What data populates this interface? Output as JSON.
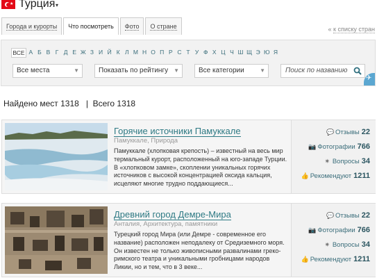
{
  "header": {
    "country": "Турция",
    "back_link": "к списку стран"
  },
  "tabs": [
    {
      "label": "Города и курорты"
    },
    {
      "label": "Что посмотреть"
    },
    {
      "label": "Фото"
    },
    {
      "label": "О стране"
    }
  ],
  "filter": {
    "letters": [
      "ВСЕ",
      "А",
      "Б",
      "В",
      "Г",
      "Д",
      "Е",
      "Ж",
      "З",
      "И",
      "Й",
      "К",
      "Л",
      "М",
      "Н",
      "О",
      "П",
      "Р",
      "С",
      "Т",
      "У",
      "Ф",
      "Х",
      "Ц",
      "Ч",
      "Ш",
      "Щ",
      "Э",
      "Ю",
      "Я"
    ],
    "places": "Все места",
    "rating": "Показать по рейтингу",
    "categories": "Все категории",
    "search_placeholder": "Поиск по названию"
  },
  "counts": {
    "found": "Найдено мест 1318",
    "total": "Всего 1318"
  },
  "cards": [
    {
      "title": "Горячие источники Памуккале",
      "category": "Памуккале, Природа",
      "description": "Памуккале (хлопковая крепость) – известный на весь мир термальный курорт, расположенный на юго-западе Турции. В «хлопковом замке», скоплении уникальных горячих источников с высокой концентрацией оксида кальция, исцеляют многие трудно поддающиеся...",
      "stats": {
        "reviews": "22",
        "photos": "766",
        "questions": "34",
        "recommend": "1211"
      }
    },
    {
      "title": "Древний город Демре-Мира",
      "category": "Анталия, Архитектура, памятники",
      "description": "Турецкий город Мира (или Демре - современное его название) расположен неподалеку от Средиземного моря. Он известен не только живописными развалинами греко-римского театра и уникальными гробницами народов Ликии, но и тем, что в 3 веке...",
      "stats": {
        "reviews": "22",
        "photos": "766",
        "questions": "34",
        "recommend": "1211"
      }
    }
  ],
  "stat_labels": {
    "reviews": "Отзывы",
    "photos": "Фотографии",
    "questions": "Вопросы",
    "recommend": "Рекомендуют"
  }
}
